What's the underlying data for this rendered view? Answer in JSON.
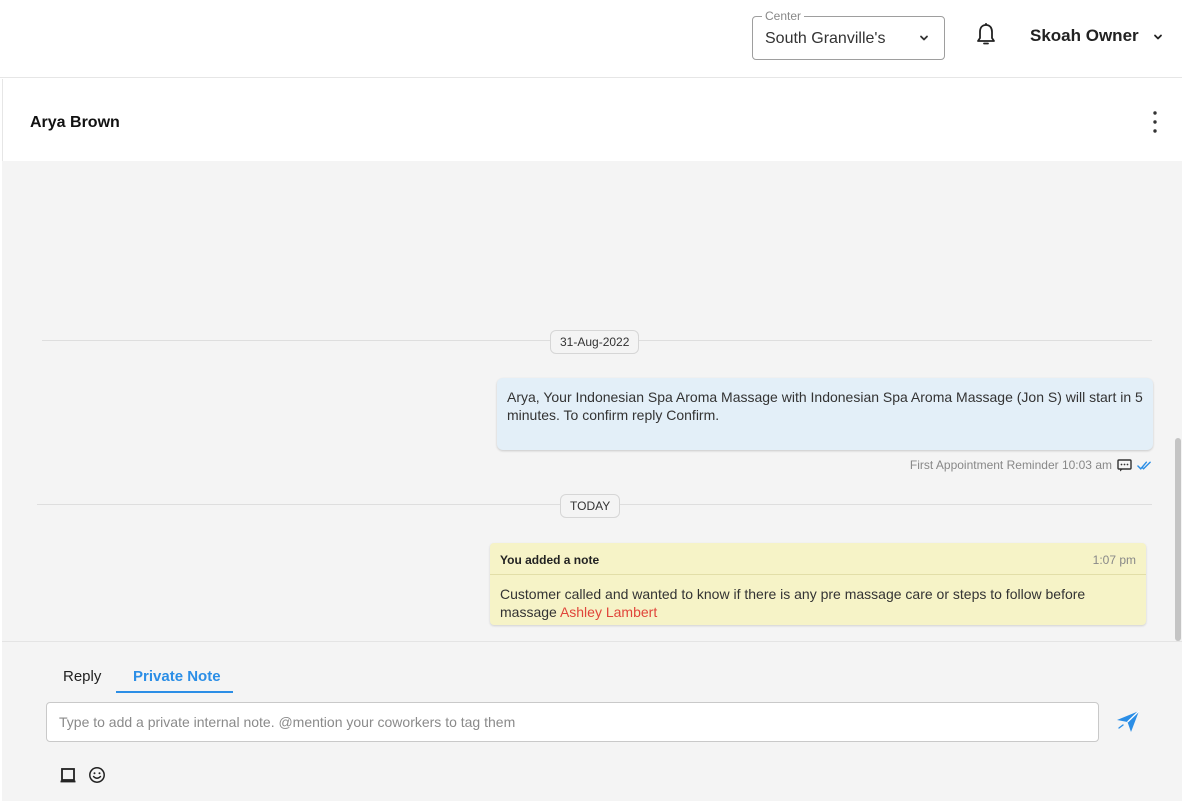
{
  "header": {
    "center_label": "Center",
    "center_value": "South Granville's",
    "user_name": "Skoah Owner",
    "icons": {
      "notifications": "bell-icon",
      "center_dropdown": "chevron-down-icon",
      "user_dropdown": "chevron-down-icon"
    }
  },
  "conversation": {
    "contact_name": "Arya Brown",
    "more_icon": "more-vertical-icon"
  },
  "messages": {
    "date_chip_1": "31-Aug-2022",
    "sms_text": "Arya, Your Indonesian Spa Aroma Massage with Indonesian Spa Aroma Massage (Jon S) will start in 5 minutes. To confirm reply Confirm.",
    "sms_meta_label": "First Appointment Reminder 10:03 am",
    "sms_icons": {
      "channel": "sms-icon",
      "status": "double-check-icon"
    },
    "date_chip_2": "TODAY",
    "note_title": "You added a note",
    "note_time": "1:07 pm",
    "note_text": "Customer called and wanted to know if there is any pre massage care or steps to follow before massage ",
    "note_mention": "Ashley Lambert"
  },
  "composer": {
    "tab_reply": "Reply",
    "tab_private_note": "Private Note",
    "active_tab": "Private Note",
    "input_value": "",
    "input_placeholder": "Type to add a private internal note. @mention your coworkers to tag them",
    "icons": {
      "send": "send-icon",
      "template": "template-icon",
      "emoji": "emoji-icon"
    }
  },
  "colors": {
    "accent": "#2b8ee6",
    "mention": "#e0453a",
    "sms_bubble": "#e3eff8",
    "note_bg": "#f6f3c7",
    "panel_bg": "#f4f4f4"
  }
}
